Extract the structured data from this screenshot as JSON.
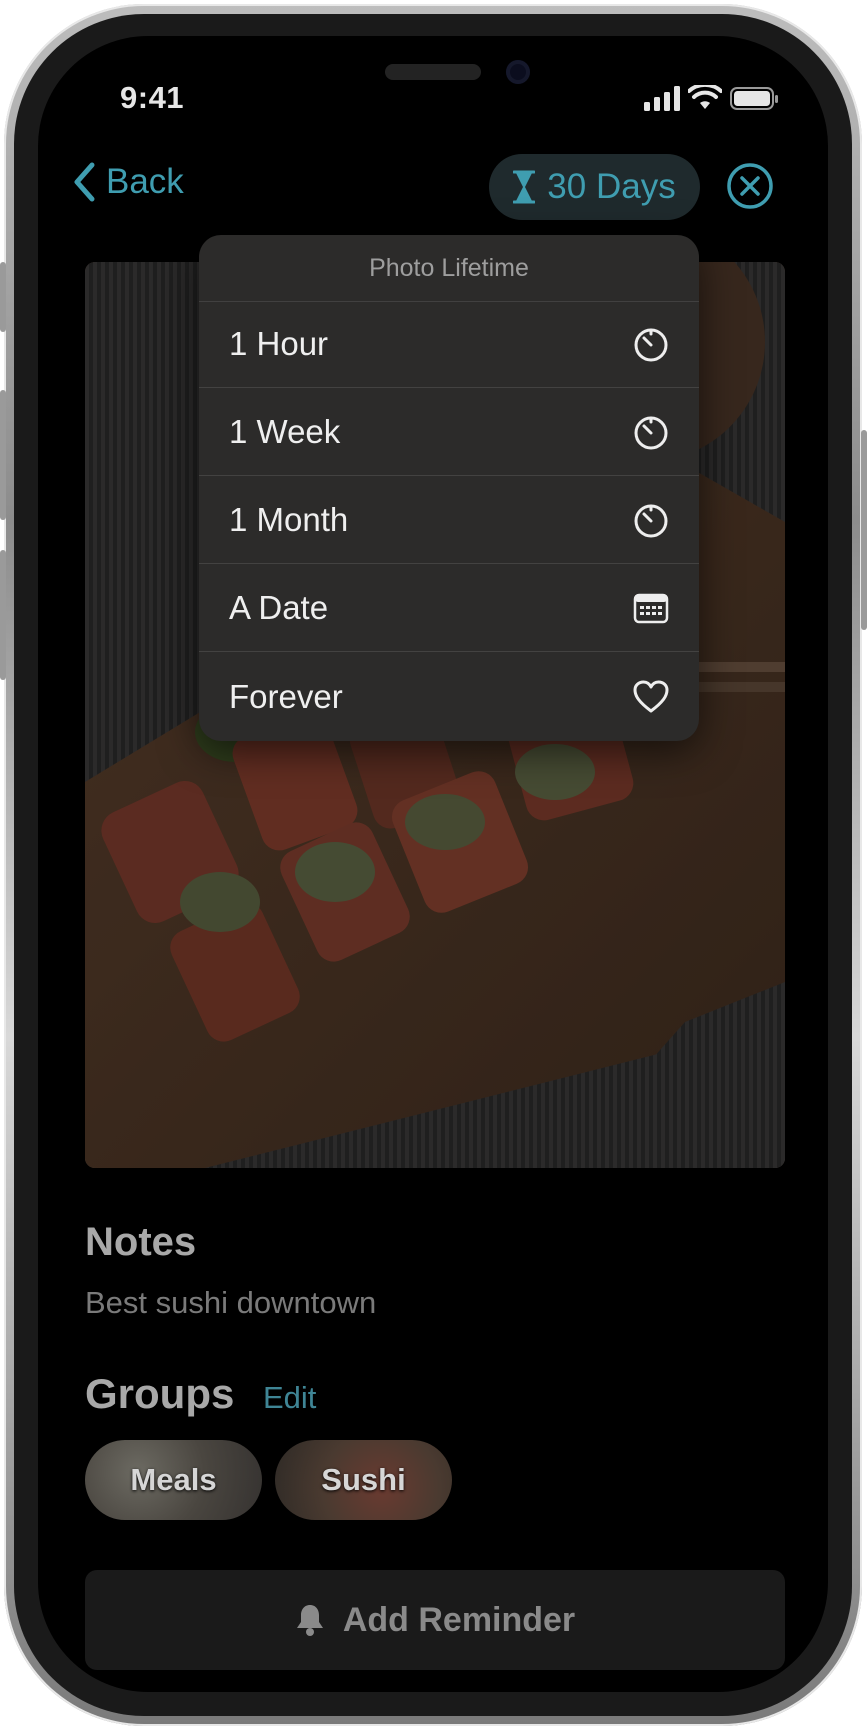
{
  "status_bar": {
    "time": "9:41"
  },
  "nav": {
    "back_label": "Back",
    "lifetime_label": "30 Days",
    "accent_color": "#3f9db0"
  },
  "lifetime_menu": {
    "title": "Photo Lifetime",
    "items": [
      {
        "label": "1 Hour",
        "icon": "timer-icon"
      },
      {
        "label": "1 Week",
        "icon": "timer-icon"
      },
      {
        "label": "1 Month",
        "icon": "timer-icon"
      },
      {
        "label": "A Date",
        "icon": "calendar-icon"
      },
      {
        "label": "Forever",
        "icon": "heart-icon"
      }
    ]
  },
  "notes": {
    "heading": "Notes",
    "text": "Best sushi downtown"
  },
  "groups": {
    "heading": "Groups",
    "edit_label": "Edit",
    "chips": [
      {
        "label": "Meals"
      },
      {
        "label": "Sushi"
      }
    ]
  },
  "reminder": {
    "label": "Add Reminder",
    "icon": "bell-icon"
  }
}
